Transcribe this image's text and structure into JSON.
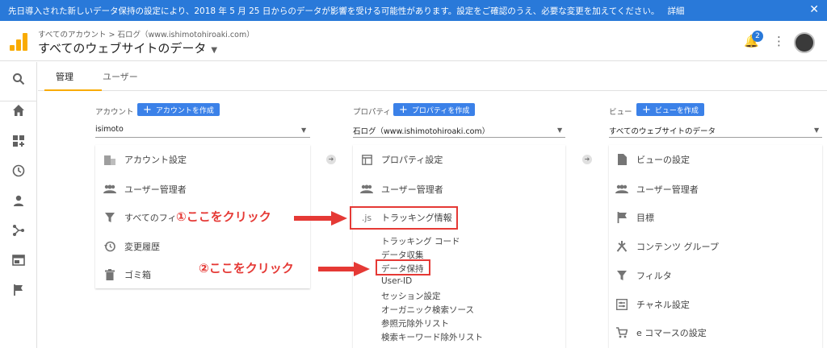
{
  "banner": {
    "text": "先日導入された新しいデータ保持の設定により、2018 年 5 月 25 日からのデータが影響を受ける可能性があります。設定をご確認のうえ、必要な変更を加えてください。",
    "link": "詳細",
    "close": "✕",
    "color": "#2979d9"
  },
  "header": {
    "breadcrumb": "すべてのアカウント > 石ログ（www.ishimotohiroaki.com）",
    "title": "すべてのウェブサイトのデータ",
    "notification_count": "2"
  },
  "tabs": [
    {
      "label": "管理",
      "active": true
    },
    {
      "label": "ユーザー",
      "active": false
    }
  ],
  "columns": {
    "account": {
      "heading": "アカウント",
      "create_label": "アカウントを作成",
      "selected": "isimoto",
      "items": [
        "アカウント設定",
        "ユーザー管理者",
        "すべてのフィ",
        "変更履歴",
        "ゴミ箱"
      ]
    },
    "property": {
      "heading": "プロパティ",
      "create_label": "プロパティを作成",
      "selected": "石ログ（www.ishimotohiroaki.com）",
      "items": [
        "プロパティ設定",
        "ユーザー管理者",
        "トラッキング情報"
      ],
      "js_label": ".js",
      "sub_items": [
        "トラッキング コード",
        "データ収集",
        "データ保持",
        "User-ID",
        "セッション設定",
        "オーガニック検索ソース",
        "参照元除外リスト",
        "検索キーワード除外リスト"
      ]
    },
    "view": {
      "heading": "ビュー",
      "create_label": "ビューを作成",
      "selected": "すべてのウェブサイトのデータ",
      "items": [
        "ビューの設定",
        "ユーザー管理者",
        "目標",
        "コンテンツ グループ",
        "フィルタ",
        "チャネル設定",
        "e コマースの設定"
      ]
    }
  },
  "annotations": {
    "first": "①ここをクリック",
    "second": "②ここをクリック",
    "color": "#e53935"
  }
}
